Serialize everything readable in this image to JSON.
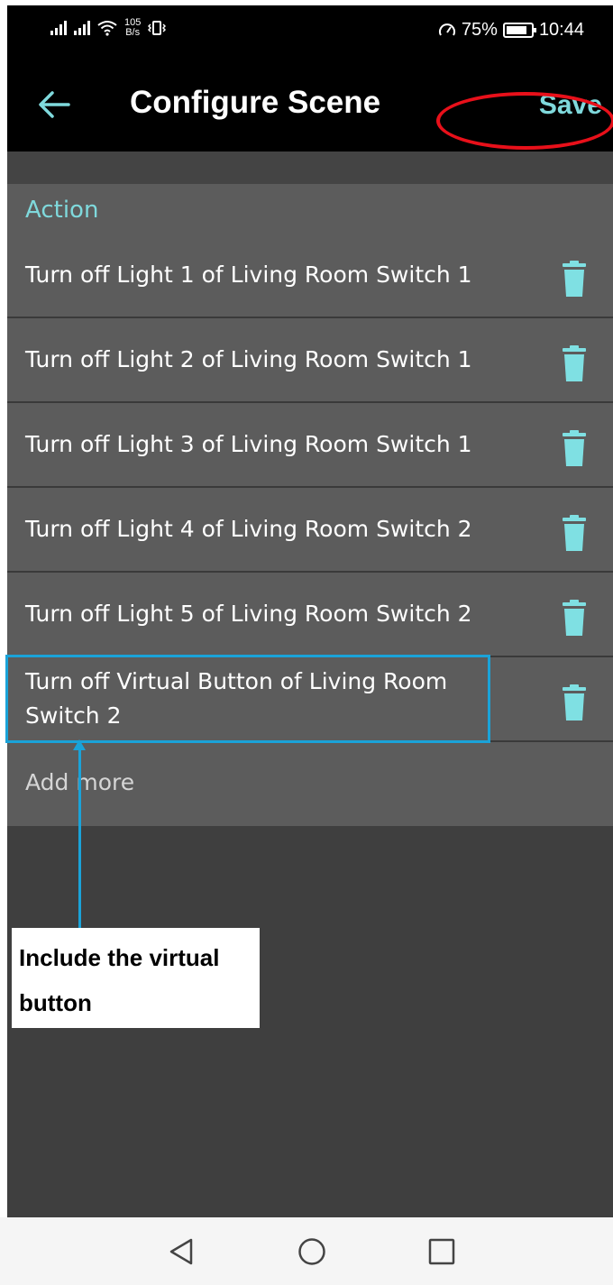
{
  "status_bar": {
    "net_speed_value": "105",
    "net_speed_unit": "B/s",
    "battery_percent": "75%",
    "time": "10:44"
  },
  "header": {
    "title": "Configure Scene",
    "save_label": "Save"
  },
  "section": {
    "label": "Action"
  },
  "actions": [
    {
      "label": "Turn off Light 1 of Living Room Switch 1"
    },
    {
      "label": "Turn off Light 2 of Living Room Switch 1"
    },
    {
      "label": "Turn off Light 3 of Living Room Switch 1"
    },
    {
      "label": "Turn off Light 4 of Living Room Switch 2"
    },
    {
      "label": "Turn off Light 5 of Living Room Switch 2"
    },
    {
      "label": "Turn off Virtual Button of Living Room Switch 2"
    }
  ],
  "add_more_label": "Add more",
  "annotation": {
    "text": "Include the virtual button"
  },
  "colors": {
    "accent": "#7fd9dc",
    "save_highlight": "#e8101a",
    "annotation": "#1aa3d9"
  }
}
